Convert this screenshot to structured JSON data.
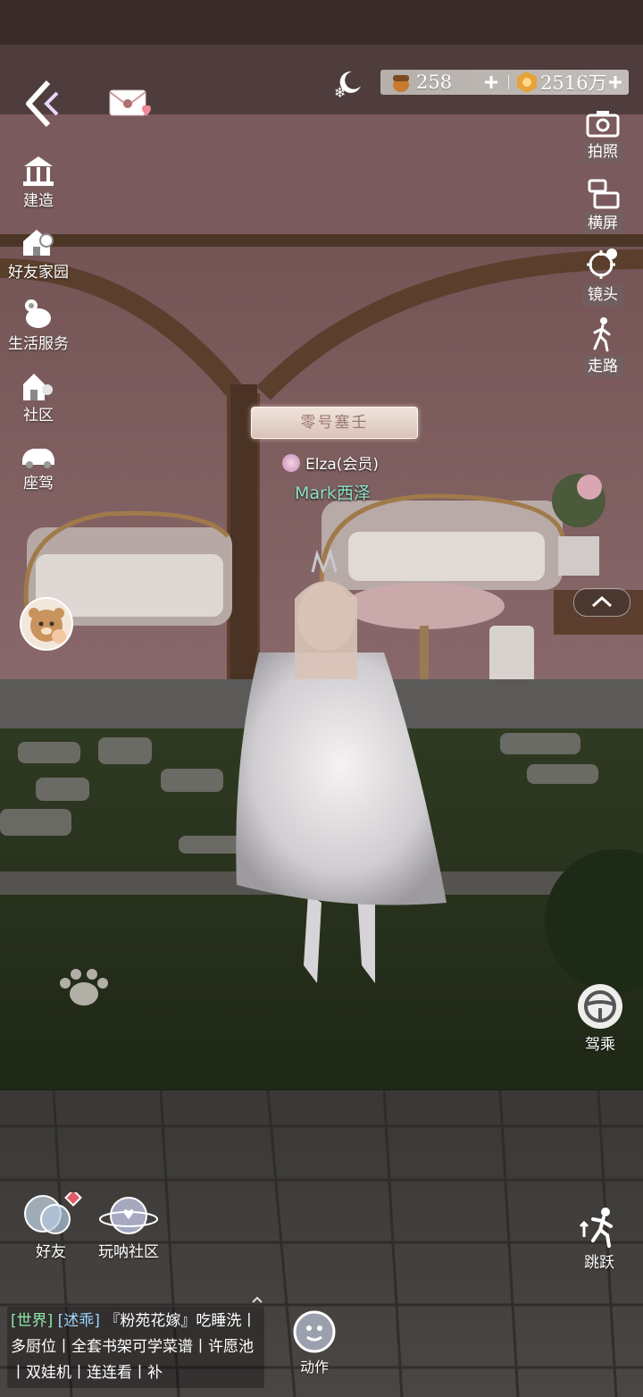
{
  "currency": {
    "acorns": "258",
    "coins": "2516万"
  },
  "left_menu": [
    {
      "label": "建造",
      "icon": "building-icon"
    },
    {
      "label": "好友家园",
      "icon": "friend-home-icon"
    },
    {
      "label": "生活服务",
      "icon": "life-service-icon"
    },
    {
      "label": "社区",
      "icon": "community-icon"
    },
    {
      "label": "座驾",
      "icon": "car-icon"
    }
  ],
  "right_menu": [
    {
      "label": "拍照",
      "icon": "camera-icon"
    },
    {
      "label": "横屏",
      "icon": "rotate-screen-icon"
    },
    {
      "label": "镜头",
      "icon": "lens-icon"
    },
    {
      "label": "走路",
      "icon": "walk-icon"
    }
  ],
  "character": {
    "title_plate": "零号塞壬",
    "member_name": "Elza(会员)",
    "player_name": "Mark西泽"
  },
  "actions": {
    "ride": "驾乘",
    "jump": "跳跃",
    "emote": "动作",
    "friends": "好友",
    "community": "玩呐社区"
  },
  "chat": {
    "channel": "[世界]",
    "sender": "[述乖]",
    "message": "『粉苑花嫁』吃睡洗丨多厨位丨全套书架可学菜谱丨许愿池丨双娃机丨连连看丨补"
  }
}
